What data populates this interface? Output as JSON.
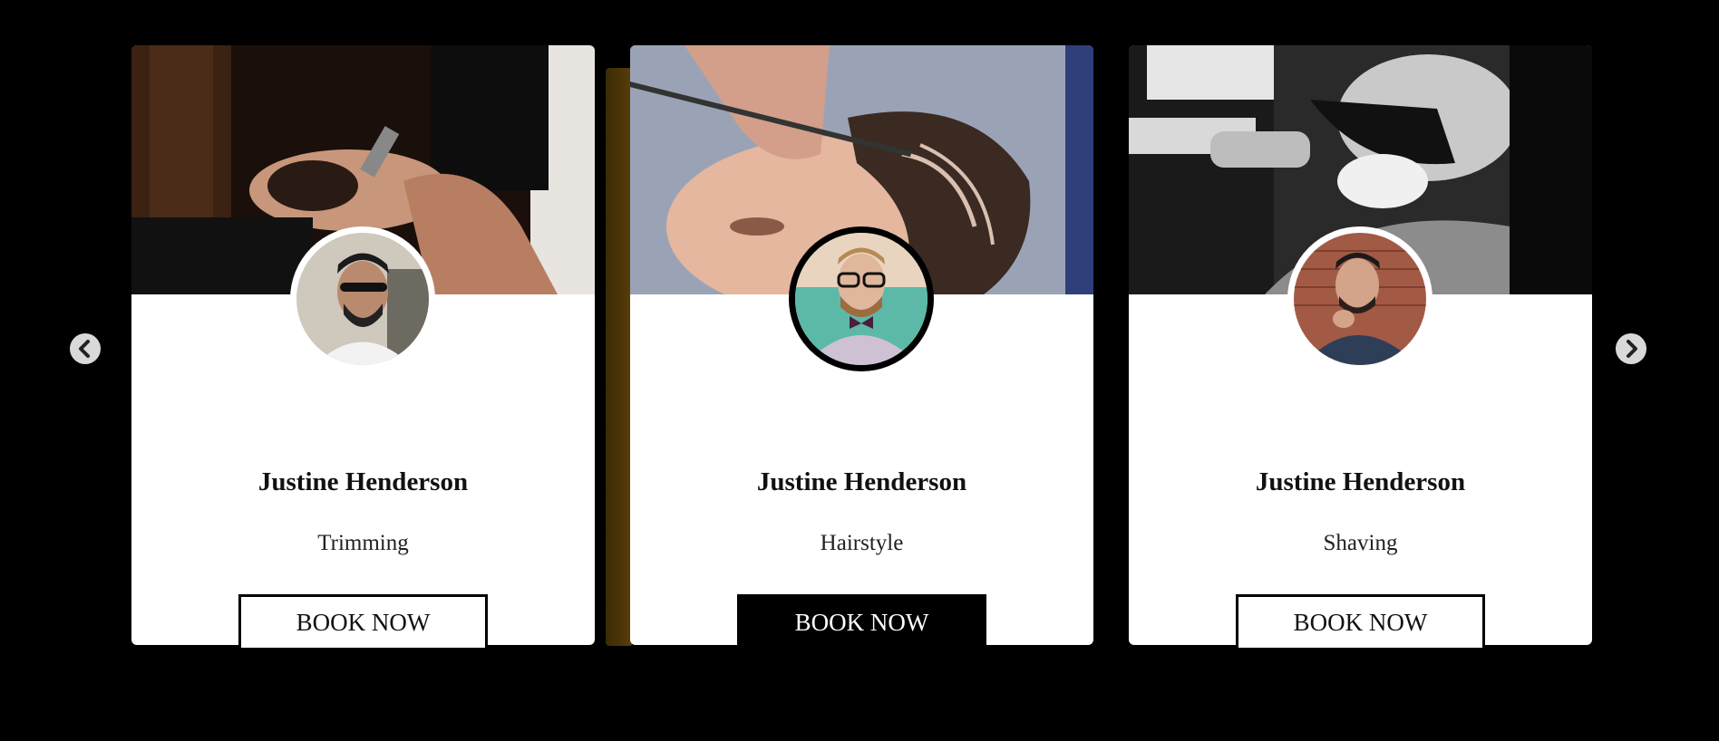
{
  "cards": [
    {
      "name": "Justine Henderson",
      "service": "Trimming",
      "button": "BOOK NOW",
      "button_style": "outline"
    },
    {
      "name": "Justine Henderson",
      "service": "Hairstyle",
      "button": "BOOK NOW",
      "button_style": "filled"
    },
    {
      "name": "Justine Henderson",
      "service": "Shaving",
      "button": "BOOK NOW",
      "button_style": "outline"
    }
  ],
  "nav": {
    "prev_icon": "chevron-left-icon",
    "next_icon": "chevron-right-icon"
  },
  "colors": {
    "background": "#000000",
    "card": "#ffffff",
    "accent_strip": "#5a3f08",
    "button_filled": "#000000"
  }
}
